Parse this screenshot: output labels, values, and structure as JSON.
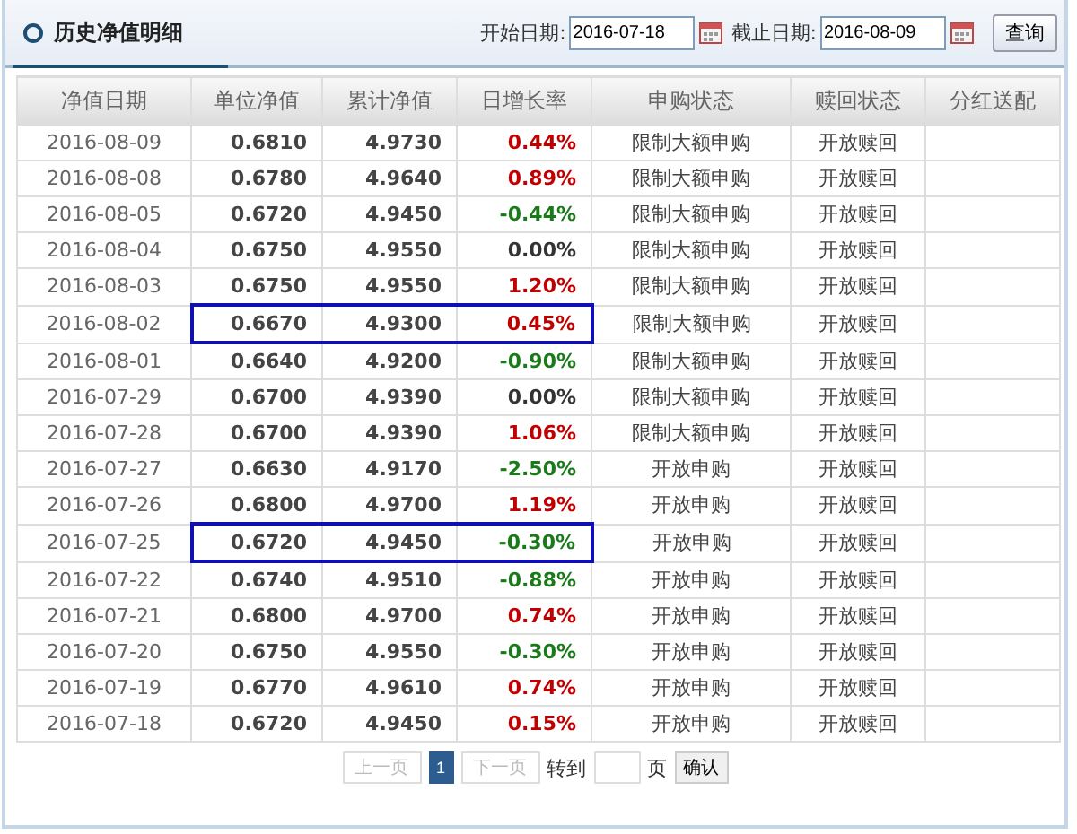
{
  "panel": {
    "title": "历史净值明细"
  },
  "filter": {
    "start_label": "开始日期:",
    "start_value": "2016-07-18",
    "end_label": "截止日期:",
    "end_value": "2016-08-09",
    "query_button": "查询"
  },
  "table": {
    "columns": [
      "净值日期",
      "单位净值",
      "累计净值",
      "日增长率",
      "申购状态",
      "赎回状态",
      "分红送配"
    ],
    "rows": [
      {
        "date": "2016-08-09",
        "nav": "0.6810",
        "acc": "4.9730",
        "rate": "0.44%",
        "color": "#c00000",
        "buy": "限制大额申购",
        "redeem": "开放赎回",
        "highlighted": false
      },
      {
        "date": "2016-08-08",
        "nav": "0.6780",
        "acc": "4.9640",
        "rate": "0.89%",
        "color": "#c00000",
        "buy": "限制大额申购",
        "redeem": "开放赎回",
        "highlighted": false
      },
      {
        "date": "2016-08-05",
        "nav": "0.6720",
        "acc": "4.9450",
        "rate": "-0.44%",
        "color": "#1a7a1a",
        "buy": "限制大额申购",
        "redeem": "开放赎回",
        "highlighted": false
      },
      {
        "date": "2016-08-04",
        "nav": "0.6750",
        "acc": "4.9550",
        "rate": "0.00%",
        "color": "#333333",
        "buy": "限制大额申购",
        "redeem": "开放赎回",
        "highlighted": false
      },
      {
        "date": "2016-08-03",
        "nav": "0.6750",
        "acc": "4.9550",
        "rate": "1.20%",
        "color": "#c00000",
        "buy": "限制大额申购",
        "redeem": "开放赎回",
        "highlighted": false
      },
      {
        "date": "2016-08-02",
        "nav": "0.6670",
        "acc": "4.9300",
        "rate": "0.45%",
        "color": "#c00000",
        "buy": "限制大额申购",
        "redeem": "开放赎回",
        "highlighted": true
      },
      {
        "date": "2016-08-01",
        "nav": "0.6640",
        "acc": "4.9200",
        "rate": "-0.90%",
        "color": "#1a7a1a",
        "buy": "限制大额申购",
        "redeem": "开放赎回",
        "highlighted": false
      },
      {
        "date": "2016-07-29",
        "nav": "0.6700",
        "acc": "4.9390",
        "rate": "0.00%",
        "color": "#333333",
        "buy": "限制大额申购",
        "redeem": "开放赎回",
        "highlighted": false
      },
      {
        "date": "2016-07-28",
        "nav": "0.6700",
        "acc": "4.9390",
        "rate": "1.06%",
        "color": "#c00000",
        "buy": "限制大额申购",
        "redeem": "开放赎回",
        "highlighted": false
      },
      {
        "date": "2016-07-27",
        "nav": "0.6630",
        "acc": "4.9170",
        "rate": "-2.50%",
        "color": "#1a7a1a",
        "buy": "开放申购",
        "redeem": "开放赎回",
        "highlighted": false
      },
      {
        "date": "2016-07-26",
        "nav": "0.6800",
        "acc": "4.9700",
        "rate": "1.19%",
        "color": "#c00000",
        "buy": "开放申购",
        "redeem": "开放赎回",
        "highlighted": false
      },
      {
        "date": "2016-07-25",
        "nav": "0.6720",
        "acc": "4.9450",
        "rate": "-0.30%",
        "color": "#1a7a1a",
        "buy": "开放申购",
        "redeem": "开放赎回",
        "highlighted": true
      },
      {
        "date": "2016-07-22",
        "nav": "0.6740",
        "acc": "4.9510",
        "rate": "-0.88%",
        "color": "#1a7a1a",
        "buy": "开放申购",
        "redeem": "开放赎回",
        "highlighted": false
      },
      {
        "date": "2016-07-21",
        "nav": "0.6800",
        "acc": "4.9700",
        "rate": "0.74%",
        "color": "#c00000",
        "buy": "开放申购",
        "redeem": "开放赎回",
        "highlighted": false
      },
      {
        "date": "2016-07-20",
        "nav": "0.6750",
        "acc": "4.9550",
        "rate": "-0.30%",
        "color": "#1a7a1a",
        "buy": "开放申购",
        "redeem": "开放赎回",
        "highlighted": false
      },
      {
        "date": "2016-07-19",
        "nav": "0.6770",
        "acc": "4.9610",
        "rate": "0.74%",
        "color": "#c00000",
        "buy": "开放申购",
        "redeem": "开放赎回",
        "highlighted": false
      },
      {
        "date": "2016-07-18",
        "nav": "0.6720",
        "acc": "4.9450",
        "rate": "0.15%",
        "color": "#c00000",
        "buy": "开放申购",
        "redeem": "开放赎回",
        "highlighted": false
      }
    ]
  },
  "pagination": {
    "prev": "上一页",
    "pages": [
      {
        "label": "1",
        "selected": true
      }
    ],
    "next": "下一页",
    "goto_label": "转到",
    "page_unit": "页",
    "confirm": "确认"
  }
}
